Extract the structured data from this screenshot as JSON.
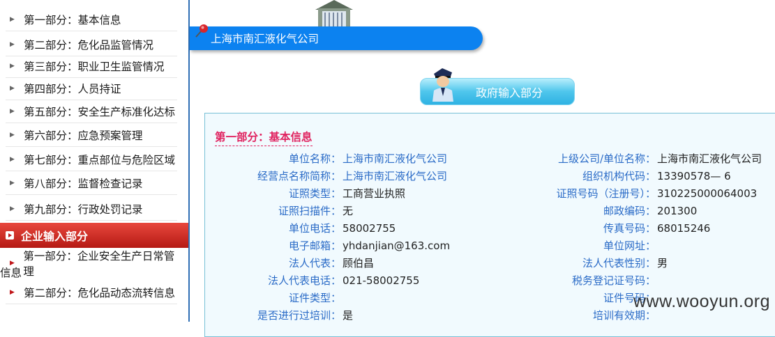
{
  "sidebar": {
    "items": [
      {
        "label": "第一部分：基本信息"
      },
      {
        "label": "第二部分：危化品监管情况"
      },
      {
        "label": "第三部分：职业卫生监管情况"
      },
      {
        "label": "第四部分：人员持证"
      },
      {
        "label": "第五部分：安全生产标准化达标"
      },
      {
        "label": "第六部分：应急预案管理"
      },
      {
        "label": "第七部分：重点部位与危险区域"
      },
      {
        "label": "第八部分：监督检查记录"
      },
      {
        "label": "第九部分：行政处罚记录"
      }
    ],
    "enterprise_header": "企业输入部分",
    "enterprise_items": [
      {
        "label": "第一部分：企业安全生产日常管理",
        "label_wrap": "信息"
      },
      {
        "label": "第二部分：危化品动态流转信息"
      }
    ]
  },
  "banner": {
    "company": "上海市南汇液化气公司"
  },
  "gov_button": {
    "label": "政府输入部分"
  },
  "section": {
    "title": "第一部分：基本信息"
  },
  "left_fields": [
    {
      "label": "单位名称：",
      "value": "上海市南汇液化气公司"
    },
    {
      "label": "经营点名称简称：",
      "value": "上海市南汇液化气公司"
    },
    {
      "label": "证照类型：",
      "value": "工商营业执照"
    },
    {
      "label": "证照扫描件：",
      "value": "无"
    },
    {
      "label": "单位电话：",
      "value": "58002755"
    },
    {
      "label": "电子邮箱：",
      "value": "yhdanjian@163.com"
    },
    {
      "label": "法人代表：",
      "value": "顾伯昌"
    },
    {
      "label": "法人代表电话：",
      "value": "021-58002755"
    },
    {
      "label": "证件类型：",
      "value": ""
    },
    {
      "label": "是否进行过培训：",
      "value": "是"
    }
  ],
  "right_fields": [
    {
      "label": "上级公司/单位名称：",
      "value": "上海市南汇液化气公司"
    },
    {
      "label": "组织机构代码：",
      "value": "13390578— 6"
    },
    {
      "label": "证照号码（注册号）：",
      "value": "310225000064003"
    },
    {
      "label": "邮政编码：",
      "value": "201300"
    },
    {
      "label": "传真号码：",
      "value": "68015246"
    },
    {
      "label": "单位网址：",
      "value": ""
    },
    {
      "label": "法人代表性别：",
      "value": "男"
    },
    {
      "label": "税务登记证号码：",
      "value": ""
    },
    {
      "label": "证件号码：",
      "value": ""
    },
    {
      "label": "培训有效期：",
      "value": ""
    }
  ],
  "watermark": "www.wooyun.org",
  "colors": {
    "banner": "#0c82f0",
    "label": "#2a6bc7",
    "section_title": "#e0225f",
    "enterprise_header": "#c0161a"
  }
}
